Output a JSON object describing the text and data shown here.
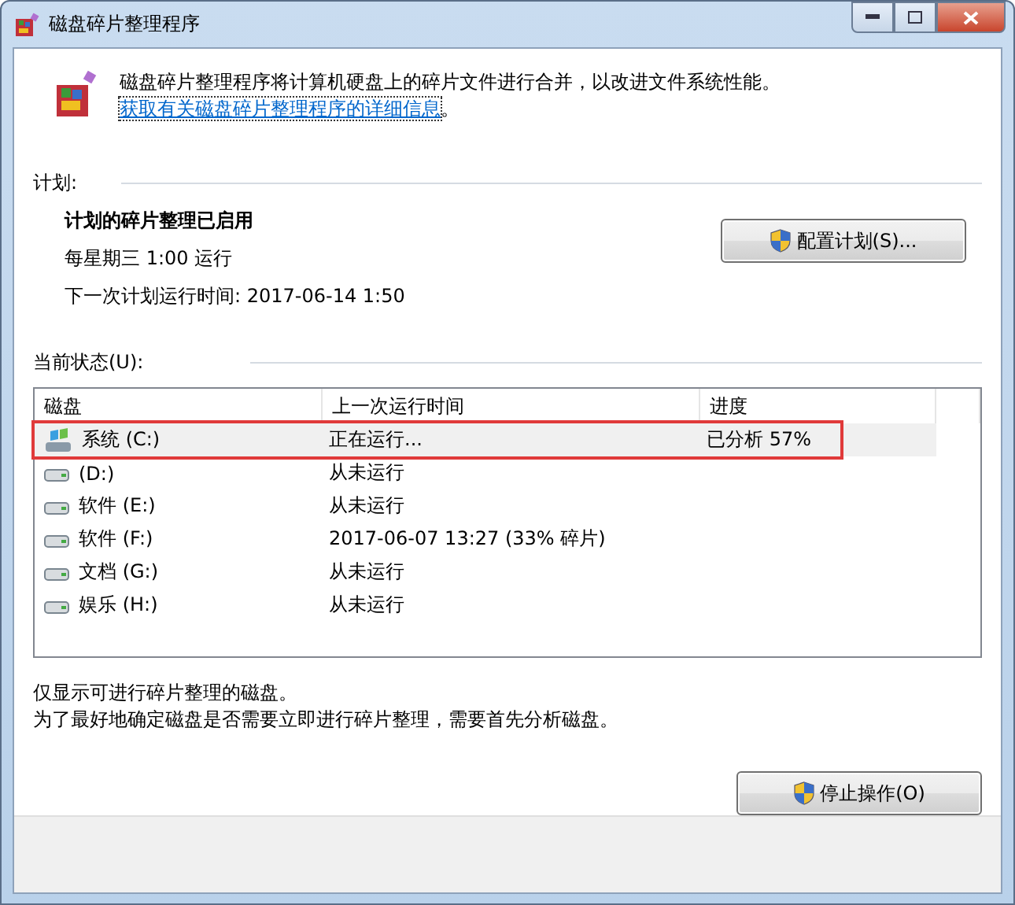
{
  "window": {
    "title": "磁盘碎片整理程序"
  },
  "intro": {
    "text": "磁盘碎片整理程序将计算机硬盘上的碎片文件进行合并，以改进文件系统性能。",
    "link": "获取有关磁盘碎片整理程序的详细信息",
    "tail": "。"
  },
  "schedule": {
    "heading": "计划:",
    "status": "计划的碎片整理已启用",
    "when": "每星期三  1:00 运行",
    "next": "下一次计划运行时间: 2017-06-14 1:50",
    "button": "配置计划(S)..."
  },
  "current": {
    "heading": "当前状态(U):"
  },
  "table": {
    "columns": [
      "磁盘",
      "上一次运行时间",
      "进度"
    ],
    "rows": [
      {
        "kind": "system",
        "disk": "系统 (C:)",
        "last_run": "正在运行...",
        "progress": "已分析 57%",
        "selected": true
      },
      {
        "kind": "drive",
        "disk": "(D:)",
        "last_run": "从未运行",
        "progress": "",
        "selected": false
      },
      {
        "kind": "drive",
        "disk": "软件 (E:)",
        "last_run": "从未运行",
        "progress": "",
        "selected": false
      },
      {
        "kind": "drive",
        "disk": "软件 (F:)",
        "last_run": "2017-06-07 13:27 (33% 碎片)",
        "progress": "",
        "selected": false
      },
      {
        "kind": "drive",
        "disk": "文档 (G:)",
        "last_run": "从未运行",
        "progress": "",
        "selected": false
      },
      {
        "kind": "drive",
        "disk": "娱乐 (H:)",
        "last_run": "从未运行",
        "progress": "",
        "selected": false
      }
    ]
  },
  "notes": [
    "仅显示可进行碎片整理的磁盘。",
    "为了最好地确定磁盘是否需要立即进行碎片整理，需要首先分析磁盘。"
  ],
  "buttons": [
    "停止操作(O)"
  ]
}
